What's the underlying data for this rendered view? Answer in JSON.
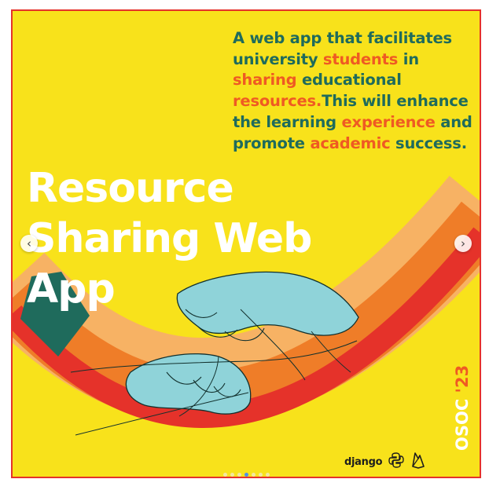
{
  "post": {
    "blurb_segments": [
      {
        "text": "A web app that facilitates university ",
        "highlight": false
      },
      {
        "text": "students",
        "highlight": true
      },
      {
        "text": " in ",
        "highlight": false
      },
      {
        "text": "sharing",
        "highlight": true
      },
      {
        "text": " educational ",
        "highlight": false
      },
      {
        "text": "resources.",
        "highlight": true
      },
      {
        "text": "This will enhance the learning ",
        "highlight": false
      },
      {
        "text": "experience",
        "highlight": true
      },
      {
        "text": " and promote ",
        "highlight": false
      },
      {
        "text": "academic",
        "highlight": true
      },
      {
        "text": " success.",
        "highlight": false
      }
    ],
    "title_lines": [
      "Resource",
      "Sharing Web",
      "App"
    ],
    "badge_name": "OSOC",
    "badge_year": "'23",
    "tech_logos": {
      "django_label": "django",
      "icons": [
        "python-logo-icon",
        "firebase-logo-icon"
      ]
    }
  },
  "carousel": {
    "prev_glyph": "‹",
    "next_glyph": "›",
    "dot_count": 7,
    "active_index": 3
  },
  "colors": {
    "background": "#f8e21b",
    "teal": "#1f6b5c",
    "orange": "#ef5a23",
    "red": "#e5322a",
    "peach": "#f7b264",
    "hand": "#8fd3d9",
    "border": "#e5322a"
  }
}
